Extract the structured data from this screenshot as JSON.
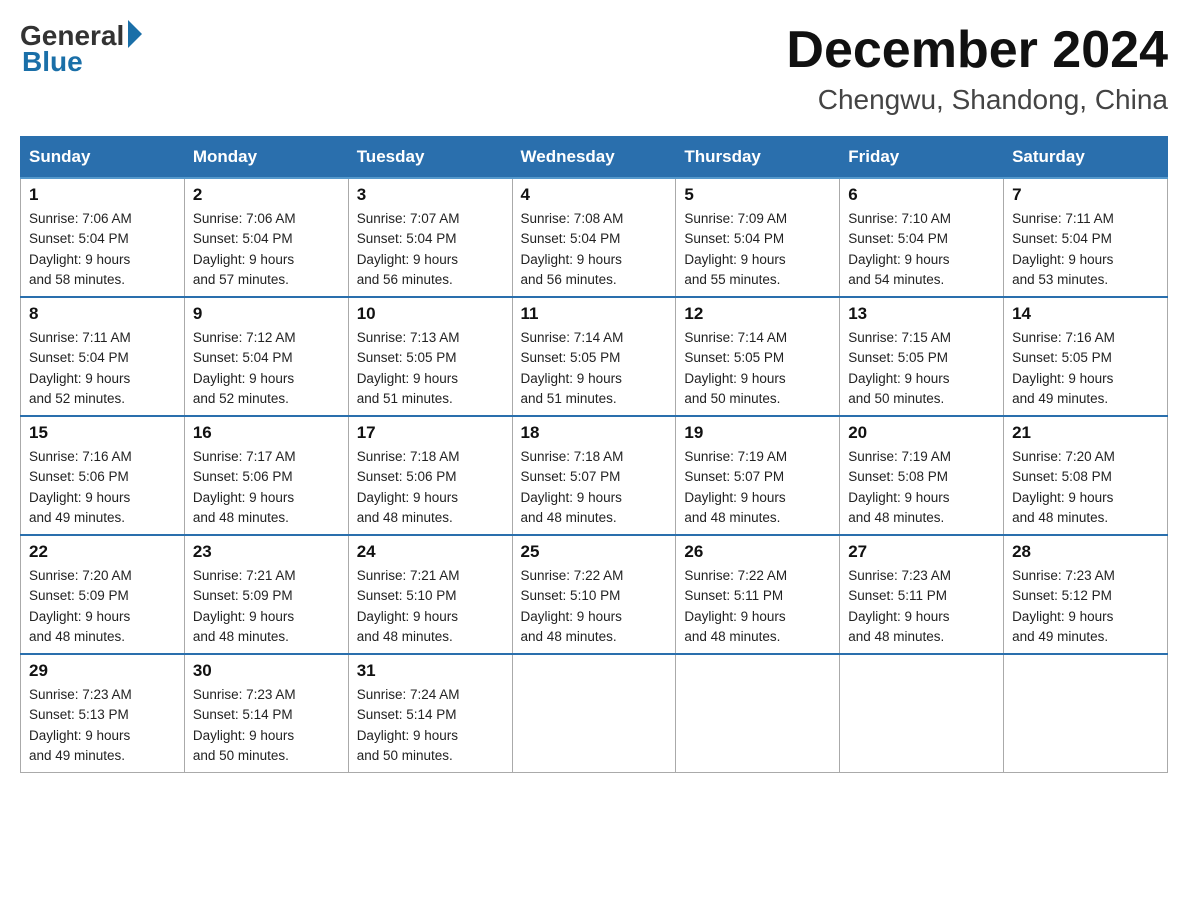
{
  "header": {
    "logo_general": "General",
    "logo_blue": "Blue",
    "title": "December 2024",
    "subtitle": "Chengwu, Shandong, China"
  },
  "days_of_week": [
    "Sunday",
    "Monday",
    "Tuesday",
    "Wednesday",
    "Thursday",
    "Friday",
    "Saturday"
  ],
  "weeks": [
    [
      {
        "day": "1",
        "sunrise": "7:06 AM",
        "sunset": "5:04 PM",
        "daylight": "9 hours and 58 minutes."
      },
      {
        "day": "2",
        "sunrise": "7:06 AM",
        "sunset": "5:04 PM",
        "daylight": "9 hours and 57 minutes."
      },
      {
        "day": "3",
        "sunrise": "7:07 AM",
        "sunset": "5:04 PM",
        "daylight": "9 hours and 56 minutes."
      },
      {
        "day": "4",
        "sunrise": "7:08 AM",
        "sunset": "5:04 PM",
        "daylight": "9 hours and 56 minutes."
      },
      {
        "day": "5",
        "sunrise": "7:09 AM",
        "sunset": "5:04 PM",
        "daylight": "9 hours and 55 minutes."
      },
      {
        "day": "6",
        "sunrise": "7:10 AM",
        "sunset": "5:04 PM",
        "daylight": "9 hours and 54 minutes."
      },
      {
        "day": "7",
        "sunrise": "7:11 AM",
        "sunset": "5:04 PM",
        "daylight": "9 hours and 53 minutes."
      }
    ],
    [
      {
        "day": "8",
        "sunrise": "7:11 AM",
        "sunset": "5:04 PM",
        "daylight": "9 hours and 52 minutes."
      },
      {
        "day": "9",
        "sunrise": "7:12 AM",
        "sunset": "5:04 PM",
        "daylight": "9 hours and 52 minutes."
      },
      {
        "day": "10",
        "sunrise": "7:13 AM",
        "sunset": "5:05 PM",
        "daylight": "9 hours and 51 minutes."
      },
      {
        "day": "11",
        "sunrise": "7:14 AM",
        "sunset": "5:05 PM",
        "daylight": "9 hours and 51 minutes."
      },
      {
        "day": "12",
        "sunrise": "7:14 AM",
        "sunset": "5:05 PM",
        "daylight": "9 hours and 50 minutes."
      },
      {
        "day": "13",
        "sunrise": "7:15 AM",
        "sunset": "5:05 PM",
        "daylight": "9 hours and 50 minutes."
      },
      {
        "day": "14",
        "sunrise": "7:16 AM",
        "sunset": "5:05 PM",
        "daylight": "9 hours and 49 minutes."
      }
    ],
    [
      {
        "day": "15",
        "sunrise": "7:16 AM",
        "sunset": "5:06 PM",
        "daylight": "9 hours and 49 minutes."
      },
      {
        "day": "16",
        "sunrise": "7:17 AM",
        "sunset": "5:06 PM",
        "daylight": "9 hours and 48 minutes."
      },
      {
        "day": "17",
        "sunrise": "7:18 AM",
        "sunset": "5:06 PM",
        "daylight": "9 hours and 48 minutes."
      },
      {
        "day": "18",
        "sunrise": "7:18 AM",
        "sunset": "5:07 PM",
        "daylight": "9 hours and 48 minutes."
      },
      {
        "day": "19",
        "sunrise": "7:19 AM",
        "sunset": "5:07 PM",
        "daylight": "9 hours and 48 minutes."
      },
      {
        "day": "20",
        "sunrise": "7:19 AM",
        "sunset": "5:08 PM",
        "daylight": "9 hours and 48 minutes."
      },
      {
        "day": "21",
        "sunrise": "7:20 AM",
        "sunset": "5:08 PM",
        "daylight": "9 hours and 48 minutes."
      }
    ],
    [
      {
        "day": "22",
        "sunrise": "7:20 AM",
        "sunset": "5:09 PM",
        "daylight": "9 hours and 48 minutes."
      },
      {
        "day": "23",
        "sunrise": "7:21 AM",
        "sunset": "5:09 PM",
        "daylight": "9 hours and 48 minutes."
      },
      {
        "day": "24",
        "sunrise": "7:21 AM",
        "sunset": "5:10 PM",
        "daylight": "9 hours and 48 minutes."
      },
      {
        "day": "25",
        "sunrise": "7:22 AM",
        "sunset": "5:10 PM",
        "daylight": "9 hours and 48 minutes."
      },
      {
        "day": "26",
        "sunrise": "7:22 AM",
        "sunset": "5:11 PM",
        "daylight": "9 hours and 48 minutes."
      },
      {
        "day": "27",
        "sunrise": "7:23 AM",
        "sunset": "5:11 PM",
        "daylight": "9 hours and 48 minutes."
      },
      {
        "day": "28",
        "sunrise": "7:23 AM",
        "sunset": "5:12 PM",
        "daylight": "9 hours and 49 minutes."
      }
    ],
    [
      {
        "day": "29",
        "sunrise": "7:23 AM",
        "sunset": "5:13 PM",
        "daylight": "9 hours and 49 minutes."
      },
      {
        "day": "30",
        "sunrise": "7:23 AM",
        "sunset": "5:14 PM",
        "daylight": "9 hours and 50 minutes."
      },
      {
        "day": "31",
        "sunrise": "7:24 AM",
        "sunset": "5:14 PM",
        "daylight": "9 hours and 50 minutes."
      },
      null,
      null,
      null,
      null
    ]
  ]
}
